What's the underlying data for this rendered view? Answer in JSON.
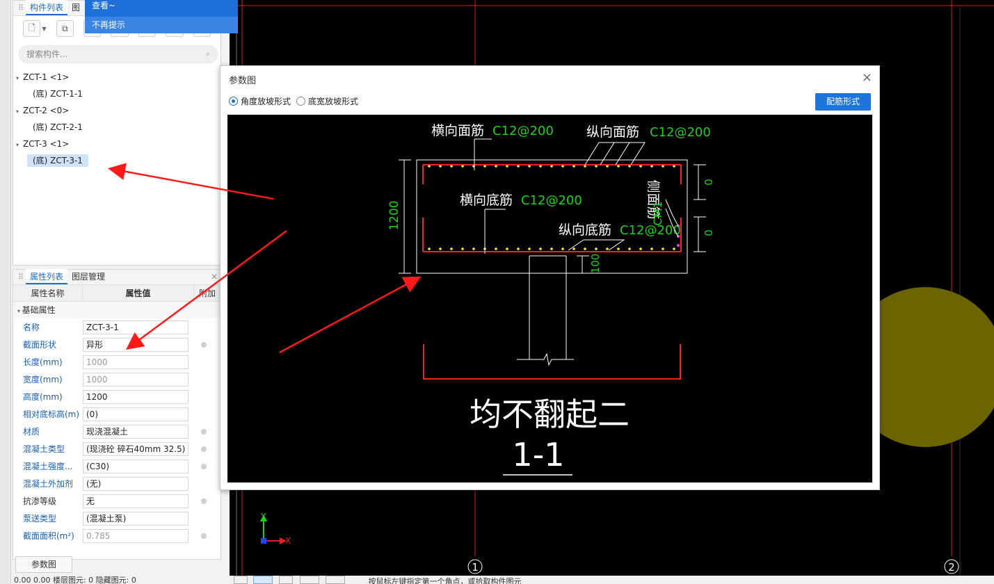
{
  "tooltip": {
    "line1": "查看~",
    "line2": "不再提示"
  },
  "component_panel": {
    "tabs": [
      "构件列表",
      "图"
    ],
    "search_placeholder": "搜索构件...",
    "tree": [
      {
        "group": "ZCT-1 <1>",
        "children": [
          "(底) ZCT-1-1"
        ]
      },
      {
        "group": "ZCT-2 <0>",
        "children": [
          "(底) ZCT-2-1"
        ]
      },
      {
        "group": "ZCT-3 <1>",
        "children": [
          "(底) ZCT-3-1"
        ]
      }
    ]
  },
  "property_panel": {
    "tabs": [
      "属性列表",
      "图层管理"
    ],
    "headers": {
      "name": "属性名称",
      "value": "属性值",
      "extra": "附加"
    },
    "section": "基础属性",
    "rows": [
      {
        "name": "名称",
        "value": "ZCT-3-1"
      },
      {
        "name": "截面形状",
        "value": "异形"
      },
      {
        "name": "长度(mm)",
        "value": "1000"
      },
      {
        "name": "宽度(mm)",
        "value": "1000"
      },
      {
        "name": "高度(mm)",
        "value": "1200"
      },
      {
        "name": "相对底标高(m)",
        "value": "(0)"
      },
      {
        "name": "材质",
        "value": "现浇混凝土"
      },
      {
        "name": "混凝土类型",
        "value": "(现浇砼 碎石40mm 32.5)"
      },
      {
        "name": "混凝土强度...",
        "value": "(C30)"
      },
      {
        "name": "混凝土外加剂",
        "value": "(无)"
      },
      {
        "name": "抗渗等级",
        "value": "无"
      },
      {
        "name": "泵送类型",
        "value": "(混凝土泵)"
      },
      {
        "name": "截面面积(m²)",
        "value": "0.785"
      }
    ],
    "param_button": "参数图"
  },
  "status_left": "0.00  0.00     楼层图元: 0     隐藏图元: 0",
  "canvas": {
    "axis_labels": [
      "1",
      "2"
    ],
    "ucs": {
      "x": "X",
      "y": "Y"
    }
  },
  "bottom_toolbar": {
    "hint": "按鼠标左键指定第一个角点，或拾取构件图元"
  },
  "dialog": {
    "title": "参数图",
    "close": "×",
    "radio_options": [
      "角度放坡形式",
      "底宽放坡形式"
    ],
    "rebar_button": "配筋形式",
    "drawing": {
      "top_transverse": "横向面筋",
      "top_transverse_spec": "C12@200",
      "top_longitudinal": "纵向面筋",
      "top_longitudinal_spec": "C12@200",
      "bottom_transverse": "横向底筋",
      "bottom_transverse_spec": "C12@200",
      "bottom_longitudinal": "纵向底筋",
      "bottom_longitudinal_spec": "C12@200",
      "side_rebar": "侧面筋",
      "side_rebar_spec": "CM1",
      "height": "1200",
      "dim_top": "0",
      "dim_bottom": "0",
      "dim_cover": "100",
      "note": "均不翻起二",
      "section": "1-1"
    }
  }
}
